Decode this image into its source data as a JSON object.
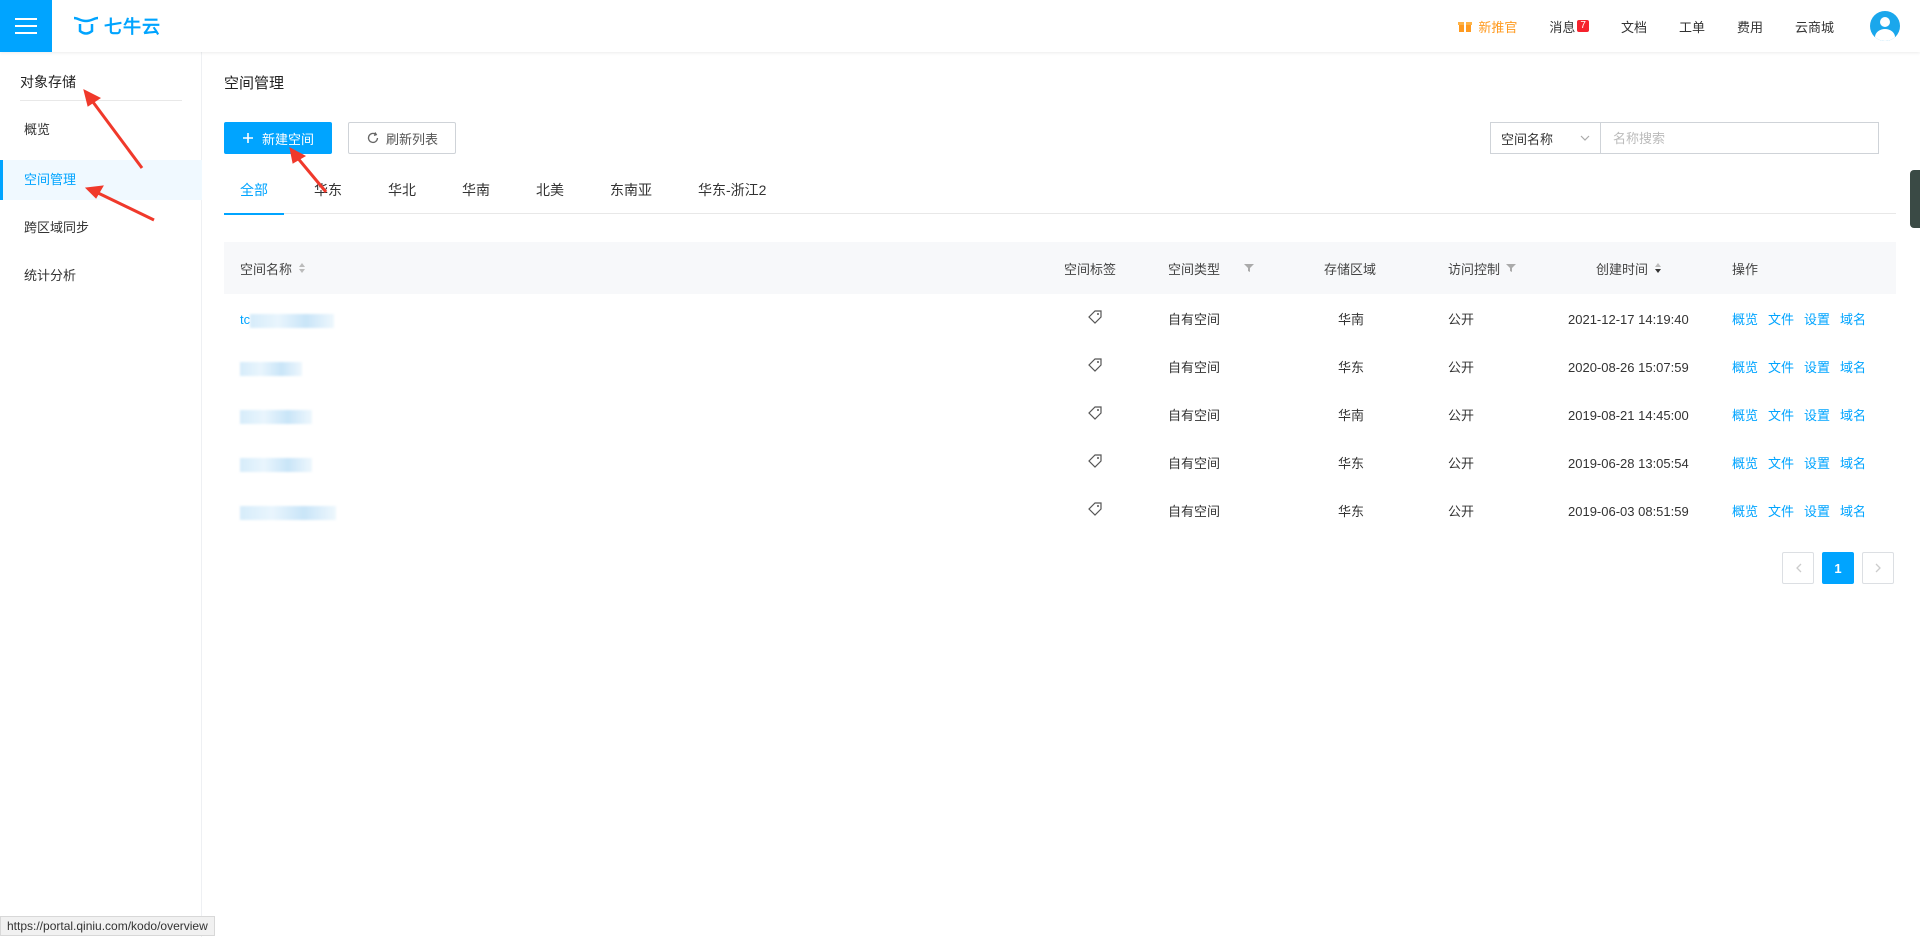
{
  "topbar": {
    "logo_text": "七牛云",
    "promo": "新推官",
    "messages": "消息",
    "messages_badge": "7",
    "docs": "文档",
    "tickets": "工单",
    "billing": "费用",
    "mall": "云商城"
  },
  "sidebar": {
    "title": "对象存储",
    "items": [
      {
        "label": "概览"
      },
      {
        "label": "空间管理"
      },
      {
        "label": "跨区域同步"
      },
      {
        "label": "统计分析"
      }
    ]
  },
  "main": {
    "title": "空间管理",
    "new_button": "新建空间",
    "refresh_button": "刷新列表",
    "search_select": "空间名称",
    "search_placeholder": "名称搜索",
    "tabs": [
      "全部",
      "华东",
      "华北",
      "华南",
      "北美",
      "东南亚",
      "华东-浙江2"
    ],
    "table": {
      "headers": {
        "name": "空间名称",
        "tag": "空间标签",
        "type": "空间类型",
        "region": "存储区域",
        "access": "访问控制",
        "created": "创建时间",
        "ops": "操作"
      },
      "rows": [
        {
          "name_prefix": "tc",
          "type": "自有空间",
          "region": "华南",
          "access": "公开",
          "created": "2021-12-17 14:19:40"
        },
        {
          "name_prefix": "",
          "type": "自有空间",
          "region": "华东",
          "access": "公开",
          "created": "2020-08-26 15:07:59"
        },
        {
          "name_prefix": "",
          "type": "自有空间",
          "region": "华南",
          "access": "公开",
          "created": "2019-08-21 14:45:00"
        },
        {
          "name_prefix": "",
          "type": "自有空间",
          "region": "华东",
          "access": "公开",
          "created": "2019-06-28 13:05:54"
        },
        {
          "name_prefix": "",
          "type": "自有空间",
          "region": "华东",
          "access": "公开",
          "created": "2019-06-03 08:51:59"
        }
      ],
      "ops": [
        "概览",
        "文件",
        "设置",
        "域名"
      ]
    },
    "pagination": {
      "current": "1"
    }
  },
  "status_url": "https://portal.qiniu.com/kodo/overview",
  "colors": {
    "accent": "#00a4ff",
    "promo": "#ff9a1f",
    "badge": "#f5222d",
    "arrow": "#f0392b"
  }
}
